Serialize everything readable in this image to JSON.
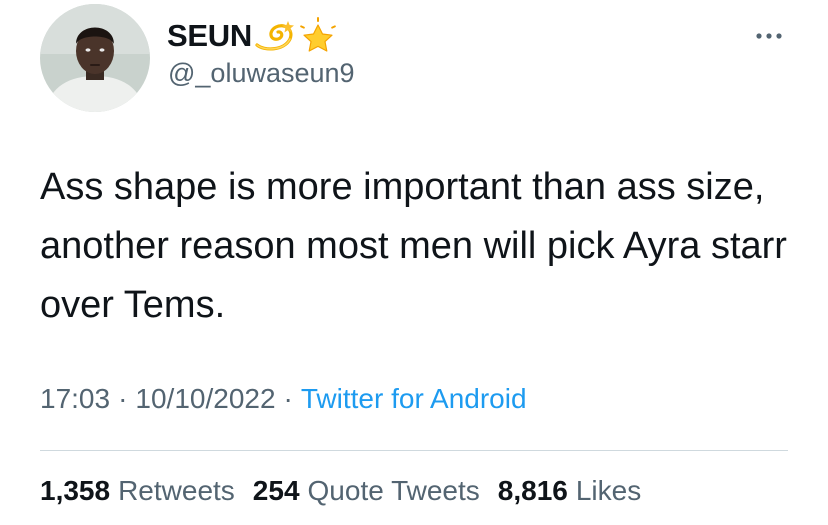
{
  "user": {
    "display_name": "SEUN",
    "handle": "@_oluwaseun9",
    "name_emojis": [
      "dizzy-icon",
      "glowing-star-icon"
    ]
  },
  "tweet": {
    "text": "Ass shape is more important than ass size, another reason most men will pick Ayra starr over Tems."
  },
  "meta": {
    "time": "17:03",
    "separator": "·",
    "date": "10/10/2022",
    "source": "Twitter for Android"
  },
  "stats": {
    "retweets_count": "1,358",
    "retweets_label": "Retweets",
    "quotes_count": "254",
    "quotes_label": "Quote Tweets",
    "likes_count": "8,816",
    "likes_label": "Likes"
  },
  "colors": {
    "text_primary": "#0f1419",
    "text_secondary": "#536471",
    "link": "#1d9bf0",
    "divider": "#cfd9de"
  },
  "icons": {
    "more": "more-options-icon"
  }
}
